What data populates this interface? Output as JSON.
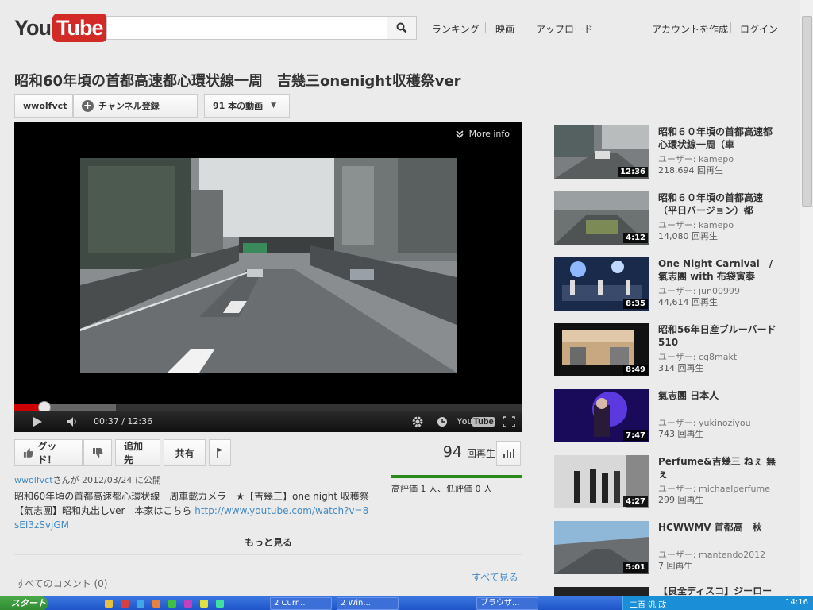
{
  "header": {
    "logo_you": "You",
    "logo_tube": "Tube",
    "search_placeholder": "",
    "nav": [
      "ランキング",
      "映画",
      "アップロード"
    ],
    "account": [
      "アカウントを作成",
      "ログイン"
    ]
  },
  "video": {
    "title": "昭和60年頃の首都高速都心環状線一周　吉幾三onenight収穫祭ver",
    "channel": "wwolfvct",
    "subscribe_label": "チャンネル登録",
    "video_count_label": "91 本の動画",
    "more_info_label": "More info",
    "current_time": "00:37",
    "duration": "12:36",
    "progress_played": 0.059,
    "progress_loaded": 0.2
  },
  "actions": {
    "like_label": "グッド！",
    "add_to_label": "追加先",
    "share_label": "共有"
  },
  "views": {
    "count": "94",
    "label": "回再生",
    "rating_text": "高評価 1 人、低評価 0 人"
  },
  "uploader": {
    "name": "wwolfvct",
    "suffix": "さんが 2012/03/24 に公開"
  },
  "description": {
    "text": "昭和60年頃の首都高速都心環状線一周車載カメラ　★【吉幾三】one night 収穫祭【氣志團】昭和丸出しver　本家はこちら ",
    "link": "http://www.youtube.com/watch?v=8sEI3zSvjGM"
  },
  "more_label": "もっと見る",
  "comments": {
    "label": "すべてのコメント (0)",
    "see_all": "すべて見る"
  },
  "related": [
    {
      "title": "昭和６０年頃の首都高速都心環状線一周（車",
      "user": "ユーザー: kamepo",
      "views": "218,694 回再生",
      "duration": "12:36"
    },
    {
      "title": "昭和６０年頃の首都高速（平日バージョン）都",
      "user": "ユーザー: kamepo",
      "views": "14,080 回再生",
      "duration": "4:12"
    },
    {
      "title": "One Night Carnival　/ 氣志團 with 布袋寅泰",
      "user": "ユーザー: jun00999",
      "views": "44,614 回再生",
      "duration": "8:35"
    },
    {
      "title": "昭和56年日産ブルーバード510",
      "user": "ユーザー: cg8makt",
      "views": "314 回再生",
      "duration": "8:49"
    },
    {
      "title": "氣志團 日本人",
      "user": "ユーザー: yukinoziyou",
      "views": "743 回再生",
      "duration": "7:47"
    },
    {
      "title": "Perfume&吉幾三 ねぇ 無ぇ",
      "user": "ユーザー: michaelperfume",
      "views": "299 回再生",
      "duration": "4:27"
    },
    {
      "title": "HCWWMV 首都高　秋",
      "user": "ユーザー: mantendo2012",
      "views": "7 回再生",
      "duration": "5:01"
    },
    {
      "title": "【良全ディスコ】ジーロー",
      "user": "",
      "views": "",
      "duration": ""
    }
  ],
  "taskbar": {
    "start_label": "スタート",
    "items": [
      "2 Curr...",
      "2 Win...",
      "ブラウザ...",
      "二百 汎 政"
    ],
    "clock": "14:16"
  }
}
